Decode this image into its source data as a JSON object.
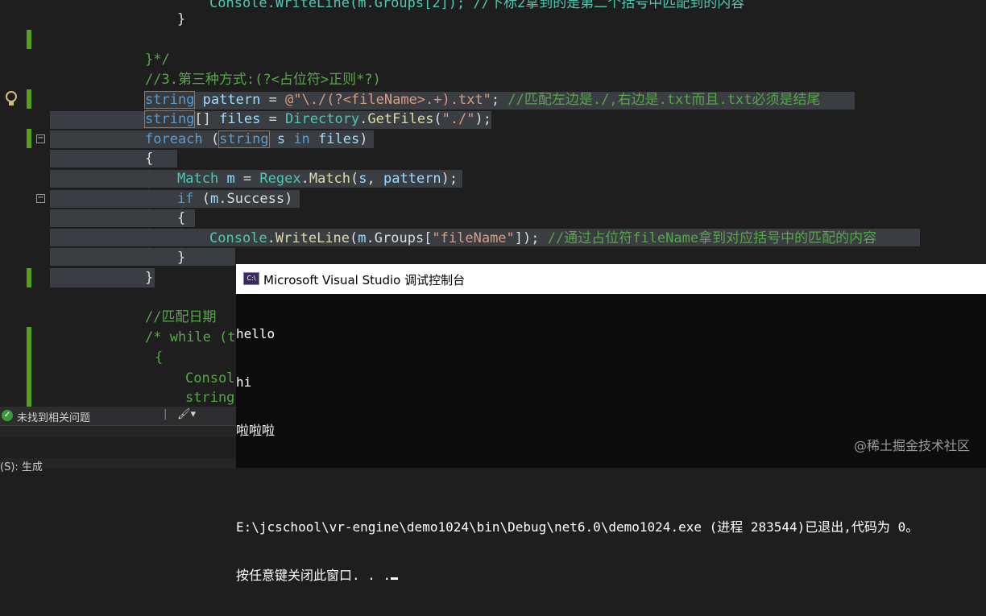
{
  "editor": {
    "lines": {
      "l0": "Console.WriteLine(m.Groups[2]); //下标2拿到的是第二个括号中匹配到的内容",
      "l1": "}",
      "l2": "}*/",
      "l3": "//3.第三种方式:(?<占位符>正则*?)",
      "l4_kw": "string",
      "l4_var": "pattern",
      "l4_op": " = ",
      "l4_str": "@\"\\./(?<fileName>.+).txt\"",
      "l4_end": ";",
      "l4_cm": " //匹配左边是./,右边是.txt而且.txt必须是结尾",
      "l5_kw": "string",
      "l5_a": "[] ",
      "l5_var": "files",
      "l5_b": " = ",
      "l5_cls": "Directory",
      "l5_c": ".",
      "l5_fn": "GetFiles",
      "l5_d": "(",
      "l5_str": "\"./\"",
      "l5_e": ");",
      "l6_kw": "foreach",
      "l6_a": " (",
      "l6_kw2": "string",
      "l6_b": " ",
      "l6_var": "s",
      "l6_c": " ",
      "l6_kw3": "in",
      "l6_d": " ",
      "l6_var2": "files",
      "l6_e": ")",
      "l7": "{",
      "l8_ty": "Match",
      "l8_a": " ",
      "l8_var": "m",
      "l8_b": " = ",
      "l8_cls": "Regex",
      "l8_c": ".",
      "l8_fn": "Match",
      "l8_d": "(",
      "l8_var2": "s",
      "l8_e": ", ",
      "l8_var3": "pattern",
      "l8_f": ");",
      "l9_kw": "if",
      "l9_a": " (",
      "l9_var": "m",
      "l9_b": ".Success)",
      "l10": "{",
      "l11_cls": "Console",
      "l11_a": ".",
      "l11_fn": "WriteLine",
      "l11_b": "(",
      "l11_var": "m",
      "l11_c": ".Groups[",
      "l11_str": "\"fileName\"",
      "l11_d": "]);",
      "l11_cm": " //通过占位符fileName拿到对应括号中的匹配的内容",
      "l12": "}",
      "l13": "}",
      "l14": "//匹配日期",
      "l15": "/* while (t",
      "l16": "{",
      "l17": "Consol",
      "l18": "string"
    }
  },
  "status_bar": {
    "issues_text": "未找到相关问题",
    "brush_glyph": "🖌▾"
  },
  "bottom_panel": {
    "label": "(S): 生成"
  },
  "console": {
    "title": "Microsoft Visual Studio 调试控制台",
    "icon_text": "C:\\",
    "output": [
      "hello",
      "hi",
      "啦啦啦",
      "",
      "E:\\jcschool\\vr-engine\\demo1024\\bin\\Debug\\net6.0\\demo1024.exe (进程 283544)已退出,代码为 0。",
      "按任意键关闭此窗口. . ."
    ]
  },
  "watermark": "@稀土掘金技术社区",
  "colors": {
    "editor_bg": "#1e1e1e",
    "keyword": "#569cd6",
    "comment": "#57a64a",
    "string": "#d69d85",
    "type": "#4ec9b0",
    "change_bar": "#57a01e"
  }
}
